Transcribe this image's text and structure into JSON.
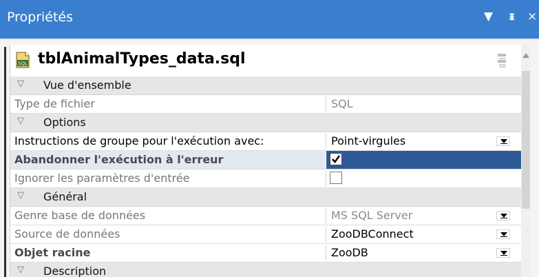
{
  "panel": {
    "title": "Propriétés",
    "buttons": {
      "dropdown": "▼",
      "pin": "ᵻ",
      "close": "×"
    }
  },
  "file": {
    "name": "tblAnimalTypes_data.sql",
    "icon": "sql-file-icon"
  },
  "sections": [
    {
      "label": "Vue d'ensemble",
      "rows": [
        {
          "name": "Type de fichier",
          "value": "SQL"
        }
      ]
    },
    {
      "label": "Options",
      "rows": [
        {
          "name": "Instructions de groupe pour l'exécution avec:",
          "value": "Point-virgules"
        },
        {
          "name": "Abandonner l'exécution à l'erreur",
          "checked": true
        },
        {
          "name": "Ignorer les paramètres d'entrée",
          "checked": false
        }
      ]
    },
    {
      "label": "Général",
      "rows": [
        {
          "name": "Genre base de données",
          "value": "MS SQL Server"
        },
        {
          "name": "Source de données",
          "value": "ZooDBConnect"
        },
        {
          "name": "Objet racine",
          "value": "ZooDB"
        }
      ]
    },
    {
      "label": "Description",
      "rows": []
    }
  ],
  "colors": {
    "titlebar": "#3a7fcf",
    "selected_value": "#2e5a98",
    "selected_name": "#e4e8f1",
    "category": "#e6e6e6"
  }
}
